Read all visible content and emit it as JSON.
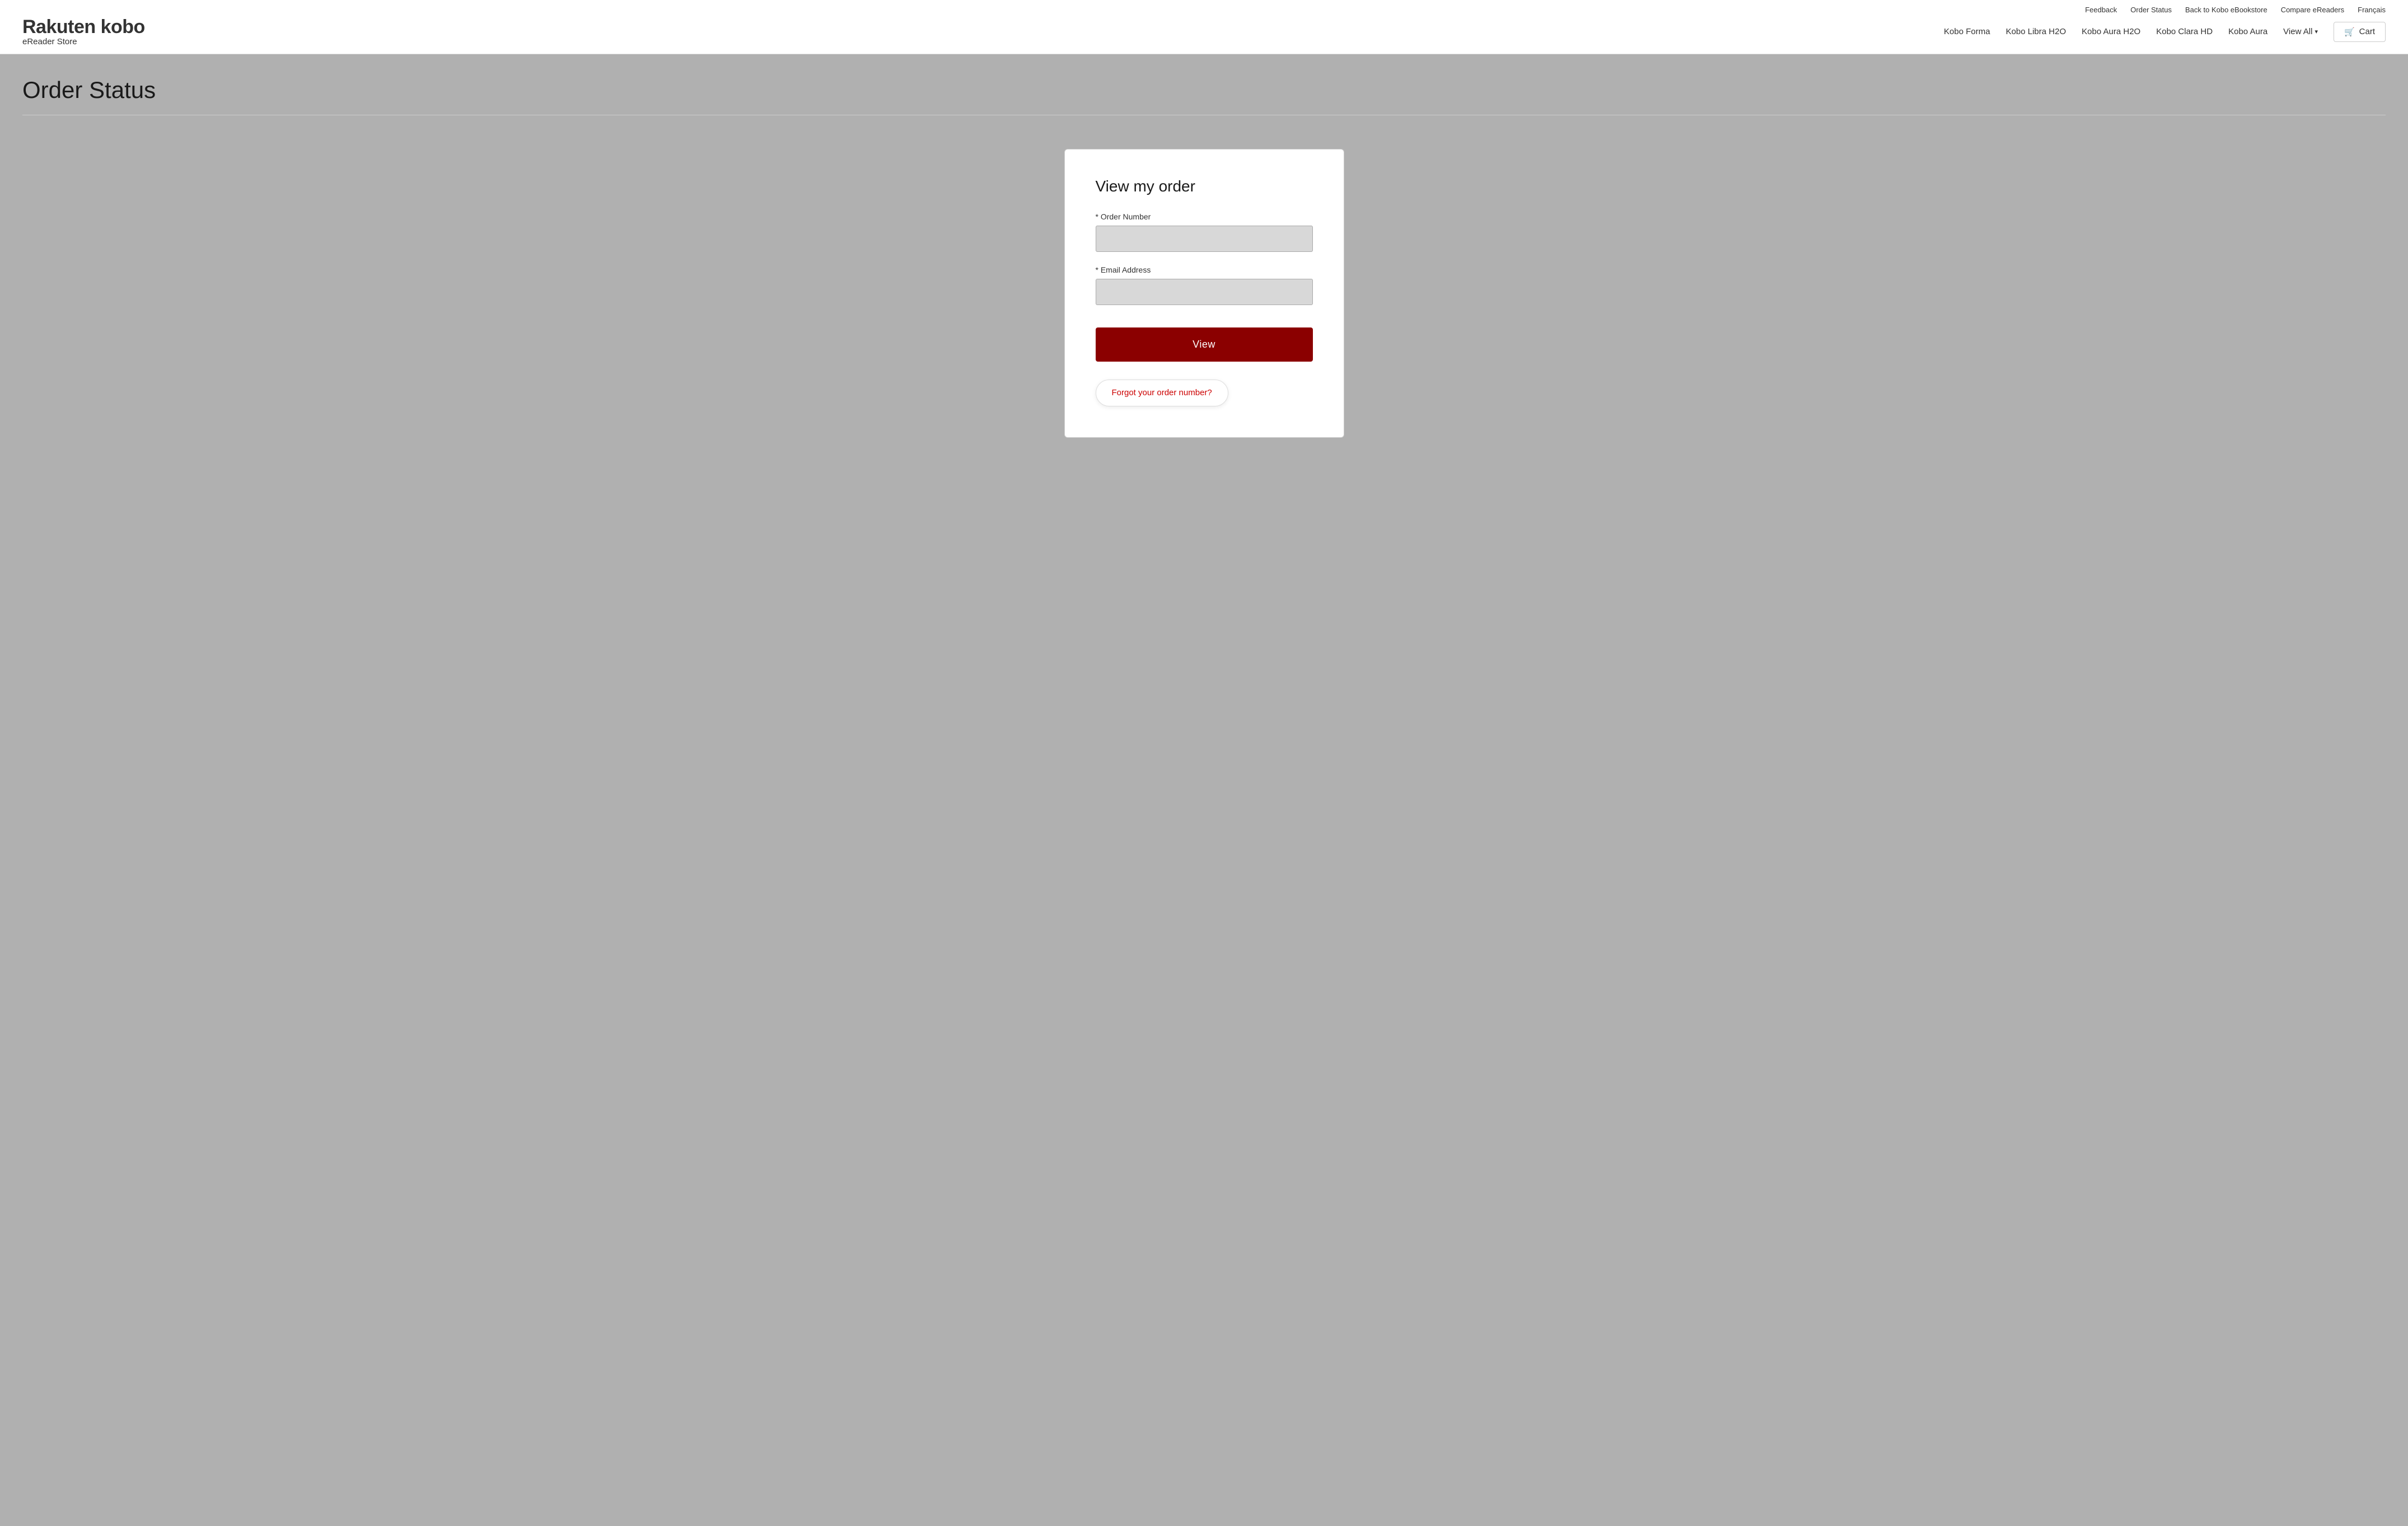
{
  "brand": {
    "rakuten": "Rakuten",
    "kobo": "kobo",
    "subtitle": "eReader Store"
  },
  "top_nav": {
    "items": [
      {
        "label": "Feedback",
        "id": "feedback"
      },
      {
        "label": "Order Status",
        "id": "order-status"
      },
      {
        "label": "Back to Kobo eBookstore",
        "id": "back-to-kobo"
      },
      {
        "label": "Compare eReaders",
        "id": "compare"
      },
      {
        "label": "Français",
        "id": "language"
      }
    ]
  },
  "main_nav": {
    "items": [
      {
        "label": "Kobo Forma",
        "id": "kobo-forma"
      },
      {
        "label": "Kobo Libra H2O",
        "id": "kobo-libra"
      },
      {
        "label": "Kobo Aura H2O",
        "id": "kobo-aura-h2o"
      },
      {
        "label": "Kobo Clara HD",
        "id": "kobo-clara"
      },
      {
        "label": "Kobo Aura",
        "id": "kobo-aura"
      },
      {
        "label": "View All",
        "id": "view-all"
      }
    ],
    "cart_label": "Cart"
  },
  "page": {
    "title": "Order Status"
  },
  "form": {
    "title": "View my order",
    "order_number_label": "* Order Number",
    "order_number_placeholder": "",
    "email_label": "* Email Address",
    "email_placeholder": "",
    "view_button_label": "View",
    "forgot_link_label": "Forgot your order number?"
  }
}
